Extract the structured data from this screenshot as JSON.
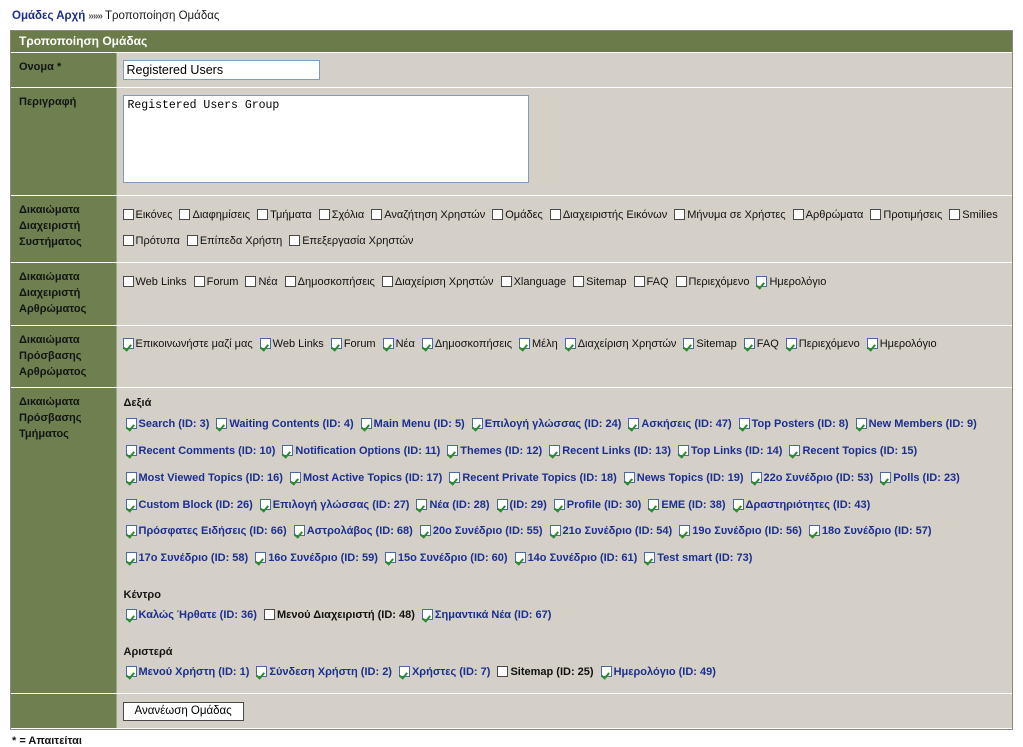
{
  "breadcrumb": {
    "home_link": "Ομάδες Αρχή",
    "separator": "»»»",
    "current": "Τροποποίηση Ομάδας"
  },
  "panel": {
    "title": "Τροποποίηση Ομάδας"
  },
  "form": {
    "name_label": "Ονομα *",
    "name_value": "Registered Users",
    "name_placeholder": "",
    "description_label": "Περιγραφή",
    "description_value": "Registered Users Group",
    "description_placeholder": "",
    "submit_label": "Ανανέωση Ομάδας"
  },
  "sections": {
    "system_admin_label": "Δικαιώματα Διαχειριστή Συστήματος",
    "module_admin_label": "Δικαιώματα Διαχειριστή Αρθρώματος",
    "module_access_label": "Δικαιώματα Πρόσβασης Αρθρώματος",
    "block_access_label": "Δικαιώματα Πρόσβασης Τμήματος"
  },
  "system_admin": [
    {
      "label": "Εικόνες",
      "checked": false
    },
    {
      "label": "Διαφημίσεις",
      "checked": false
    },
    {
      "label": "Τμήματα",
      "checked": false
    },
    {
      "label": "Σχόλια",
      "checked": false
    },
    {
      "label": "Αναζήτηση Χρηστών",
      "checked": false
    },
    {
      "label": "Ομάδες",
      "checked": false
    },
    {
      "label": "Διαχειριστής Εικόνων",
      "checked": false
    },
    {
      "label": "Μήνυμα σε Χρήστες",
      "checked": false
    },
    {
      "label": "Αρθρώματα",
      "checked": false
    },
    {
      "label": "Προτιμήσεις",
      "checked": false
    },
    {
      "label": "Smilies",
      "checked": false
    },
    {
      "label": "Πρότυπα",
      "checked": false
    },
    {
      "label": "Επίπεδα Χρήστη",
      "checked": false
    },
    {
      "label": "Επεξεργασία Χρηστών",
      "checked": false
    }
  ],
  "module_admin": [
    {
      "label": "Web Links",
      "checked": false
    },
    {
      "label": "Forum",
      "checked": false
    },
    {
      "label": "Νέα",
      "checked": false
    },
    {
      "label": "Δημοσκοπήσεις",
      "checked": false
    },
    {
      "label": "Διαχείριση Χρηστών",
      "checked": false
    },
    {
      "label": "Xlanguage",
      "checked": false
    },
    {
      "label": "Sitemap",
      "checked": false
    },
    {
      "label": "FAQ",
      "checked": false
    },
    {
      "label": "Περιεχόμενο",
      "checked": false
    },
    {
      "label": "Ημερολόγιο",
      "checked": true
    }
  ],
  "module_access": [
    {
      "label": "Επικοινωνήστε μαζί μας",
      "checked": true
    },
    {
      "label": "Web Links",
      "checked": true
    },
    {
      "label": "Forum",
      "checked": true
    },
    {
      "label": "Νέα",
      "checked": true
    },
    {
      "label": "Δημοσκοπήσεις",
      "checked": true
    },
    {
      "label": "Μέλη",
      "checked": true
    },
    {
      "label": "Διαχείριση Χρηστών",
      "checked": true
    },
    {
      "label": "Sitemap",
      "checked": true
    },
    {
      "label": "FAQ",
      "checked": true
    },
    {
      "label": "Περιεχόμενο",
      "checked": true
    },
    {
      "label": "Ημερολόγιο",
      "checked": true
    }
  ],
  "blocks": {
    "right_label": "Δεξιά",
    "center_label": "Κέντρο",
    "left_label": "Αριστερά",
    "right": [
      {
        "label": "Search (ID: 3)",
        "checked": true
      },
      {
        "label": "Waiting Contents (ID: 4)",
        "checked": true
      },
      {
        "label": "Main Menu (ID: 5)",
        "checked": true
      },
      {
        "label": "Επιλογή γλώσσας (ID: 24)",
        "checked": true
      },
      {
        "label": "Ασκήσεις (ID: 47)",
        "checked": true
      },
      {
        "label": "Top Posters (ID: 8)",
        "checked": true
      },
      {
        "label": "New Members (ID: 9)",
        "checked": true
      },
      {
        "label": "Recent Comments (ID: 10)",
        "checked": true
      },
      {
        "label": "Notification Options (ID: 11)",
        "checked": true
      },
      {
        "label": "Themes (ID: 12)",
        "checked": true
      },
      {
        "label": "Recent Links (ID: 13)",
        "checked": true
      },
      {
        "label": "Top Links (ID: 14)",
        "checked": true
      },
      {
        "label": "Recent Topics (ID: 15)",
        "checked": true
      },
      {
        "label": "Most Viewed Topics (ID: 16)",
        "checked": true
      },
      {
        "label": "Most Active Topics (ID: 17)",
        "checked": true
      },
      {
        "label": "Recent Private Topics (ID: 18)",
        "checked": true
      },
      {
        "label": "News Topics (ID: 19)",
        "checked": true
      },
      {
        "label": "22ο Συνέδριο (ID: 53)",
        "checked": true
      },
      {
        "label": "Polls (ID: 23)",
        "checked": true
      },
      {
        "label": "Custom Block (ID: 26)",
        "checked": true
      },
      {
        "label": "Επιλογή γλώσσας (ID: 27)",
        "checked": true
      },
      {
        "label": "Νέα (ID: 28)",
        "checked": true
      },
      {
        "label": "(ID: 29)",
        "checked": true
      },
      {
        "label": "Profile (ID: 30)",
        "checked": true
      },
      {
        "label": "EME (ID: 38)",
        "checked": true
      },
      {
        "label": "Δραστηριότητες (ID: 43)",
        "checked": true
      },
      {
        "label": "Πρόσφατες Ειδήσεις (ID: 66)",
        "checked": true
      },
      {
        "label": "Αστρολάβος (ID: 68)",
        "checked": true
      },
      {
        "label": "20ο Συνέδριο (ID: 55)",
        "checked": true
      },
      {
        "label": "21ο Συνέδριο (ID: 54)",
        "checked": true
      },
      {
        "label": "19ο Συνέδριο (ID: 56)",
        "checked": true
      },
      {
        "label": "18ο Συνέδριο (ID: 57)",
        "checked": true
      },
      {
        "label": "17ο Συνέδριο (ID: 58)",
        "checked": true
      },
      {
        "label": "16ο Συνέδριο (ID: 59)",
        "checked": true
      },
      {
        "label": "15ο Συνέδριο (ID: 60)",
        "checked": true
      },
      {
        "label": "14ο Συνέδριο (ID: 61)",
        "checked": true
      },
      {
        "label": "Test smart (ID: 73)",
        "checked": true
      }
    ],
    "center": [
      {
        "label": "Καλώς Ήρθατε (ID: 36)",
        "checked": true
      },
      {
        "label": "Μενού Διαχειριστή (ID: 48)",
        "checked": false
      },
      {
        "label": "Σημαντικά Νέα (ID: 67)",
        "checked": true
      }
    ],
    "left": [
      {
        "label": "Μενού Χρήστη (ID: 1)",
        "checked": true
      },
      {
        "label": "Σύνδεση Χρήστη (ID: 2)",
        "checked": true
      },
      {
        "label": "Χρήστες (ID: 7)",
        "checked": true
      },
      {
        "label": "Sitemap (ID: 25)",
        "checked": false
      },
      {
        "label": "Ημερολόγιο (ID: 49)",
        "checked": true
      }
    ]
  },
  "footer": {
    "required_note": "* = Απαιτείται"
  }
}
